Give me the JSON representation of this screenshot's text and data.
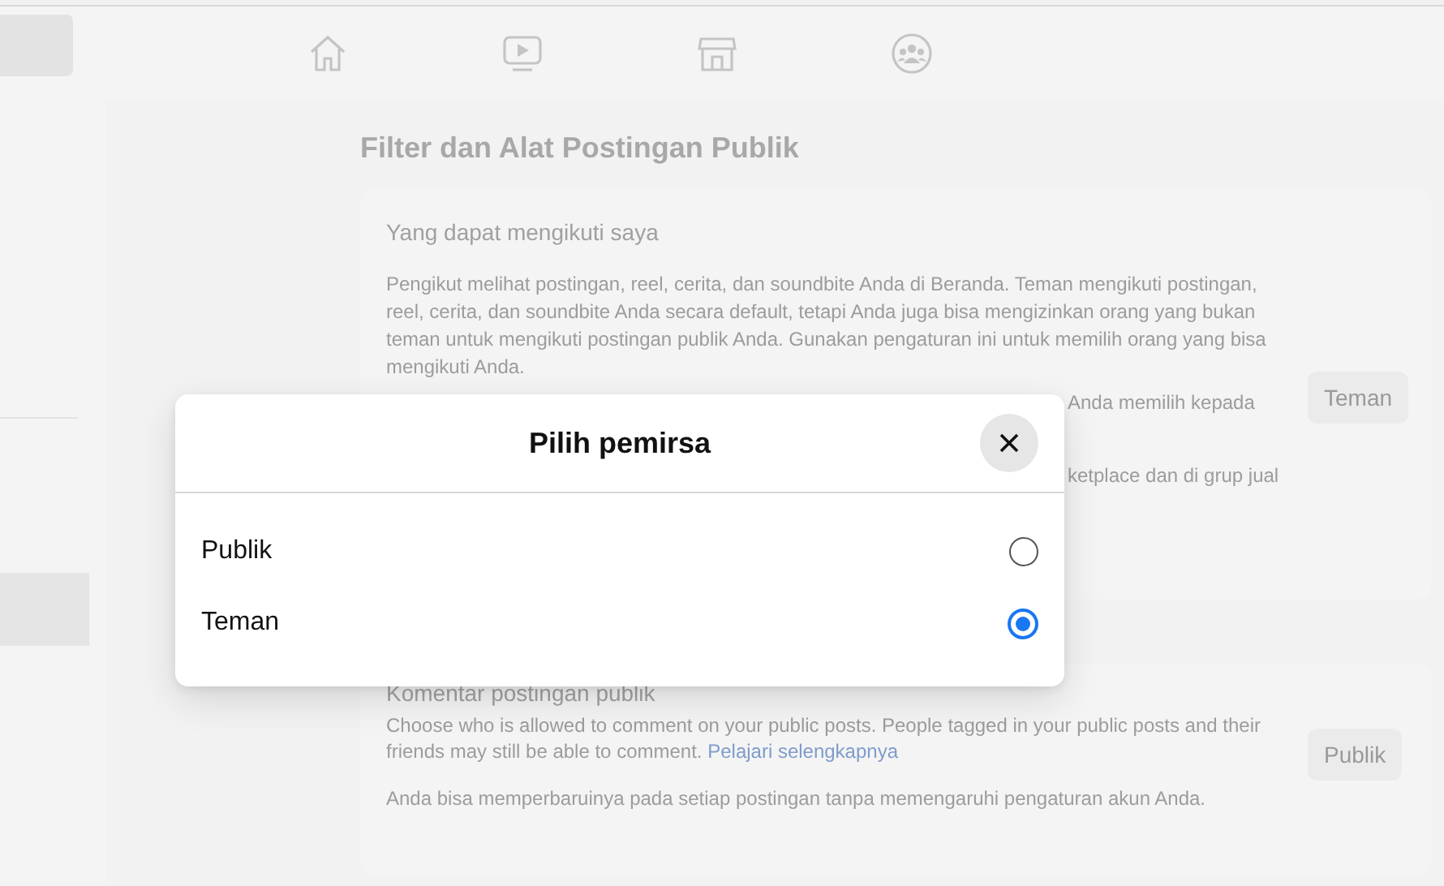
{
  "page": {
    "title": "Filter dan Alat Postingan Publik",
    "sections": [
      {
        "title": "Yang dapat mengikuti saya",
        "description": "Pengikut melihat postingan, reel, cerita, dan soundbite Anda di Beranda. Teman mengikuti postingan, reel, cerita, dan soundbite Anda secara default, tetapi Anda juga bisa mengizinkan orang yang bukan teman untuk mengikuti postingan publik Anda. Gunakan pengaturan ini untuk memilih orang yang bisa mengikuti Anda.",
        "partial_lines": [
          "Anda memilih kepada",
          "ketplace dan di grup jual"
        ],
        "value_button": "Teman"
      },
      {
        "title": "Komentar postingan publik",
        "description": "Choose who is allowed to comment on your public posts. People tagged in your public posts and their friends may still be able to comment.",
        "link": "Pelajari selengkapnya",
        "note": "Anda bisa memperbaruinya pada setiap postingan tanpa memengaruhi pengaturan akun Anda.",
        "value_button": "Publik"
      }
    ]
  },
  "dialog": {
    "title": "Pilih pemirsa",
    "options": [
      {
        "label": "Publik",
        "selected": false
      },
      {
        "label": "Teman",
        "selected": true
      }
    ]
  }
}
